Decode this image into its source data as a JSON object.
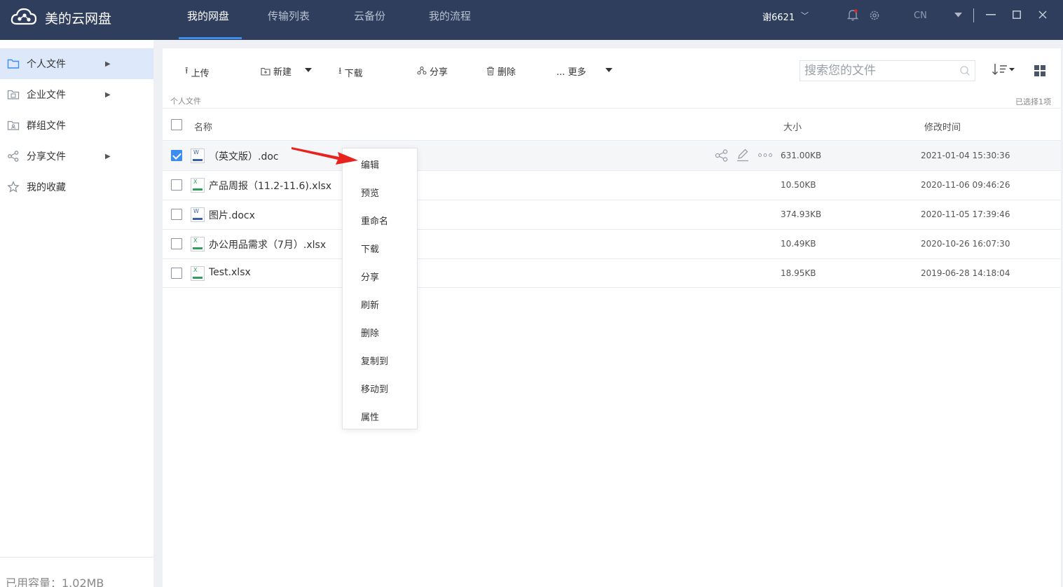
{
  "app": {
    "title": "美的云网盘"
  },
  "nav": {
    "tabs": [
      {
        "label": "我的网盘",
        "active": true
      },
      {
        "label": "传输列表"
      },
      {
        "label": "云备份"
      },
      {
        "label": "我的流程"
      }
    ]
  },
  "header": {
    "user": "谢6621",
    "lang": "CN"
  },
  "sidebar": {
    "items": [
      {
        "label": "个人文件",
        "icon": "folder-icon",
        "active": true,
        "has_arrow": true
      },
      {
        "label": "企业文件",
        "icon": "building-icon",
        "has_arrow": true
      },
      {
        "label": "群组文件",
        "icon": "group-folder-icon"
      },
      {
        "label": "分享文件",
        "icon": "share-icon",
        "has_arrow": true
      },
      {
        "label": "我的收藏",
        "icon": "star-icon"
      }
    ],
    "capacity": "已用容量：1.02MB"
  },
  "toolbar": {
    "upload": "上传",
    "new": "新建",
    "download": "下载",
    "share": "分享",
    "delete": "删除",
    "more": "... 更多",
    "search_placeholder": "搜索您的文件"
  },
  "breadcrumb": "个人文件",
  "selected_count": "已选择1项",
  "columns": {
    "name": "名称",
    "size": "大小",
    "modified": "修改时间"
  },
  "files": [
    {
      "name": "（英文版）.doc",
      "type": "word",
      "size": "631.00KB",
      "modified": "2021-01-04 15:30:36",
      "checked": true
    },
    {
      "name": "产品周报（11.2-11.6).xlsx",
      "type": "excel",
      "size": "10.50KB",
      "modified": "2020-11-06 09:46:26",
      "checked": false
    },
    {
      "name": "图片.docx",
      "type": "word",
      "size": "374.93KB",
      "modified": "2020-11-05 17:39:46",
      "checked": false
    },
    {
      "name": "办公用品需求（7月）.xlsx",
      "type": "excel",
      "size": "10.49KB",
      "modified": "2020-10-26 16:07:30",
      "checked": false
    },
    {
      "name": "Test.xlsx",
      "type": "excel",
      "size": "18.95KB",
      "modified": "2019-06-28 14:18:04",
      "checked": false
    }
  ],
  "context_menu": {
    "items": [
      "编辑",
      "预览",
      "重命名",
      "下载",
      "分享",
      "刷新",
      "删除",
      "复制到",
      "移动到",
      "属性"
    ]
  },
  "colors": {
    "header_bg": "#2e3e5c",
    "accent": "#3d8cf0",
    "annotation_arrow": "#e8231e"
  }
}
